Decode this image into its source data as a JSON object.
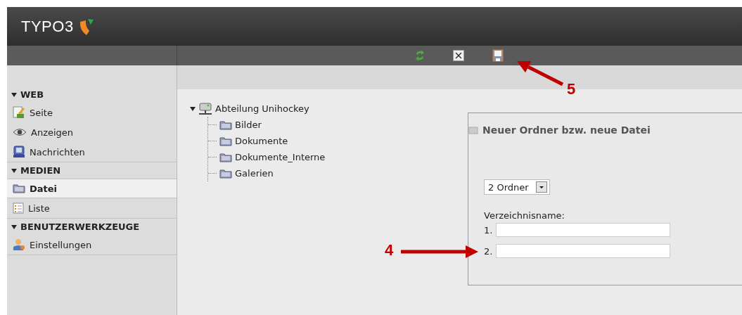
{
  "header": {
    "logo": "TYPO3"
  },
  "toolbar": {
    "buttons": [
      {
        "kind": "refresh"
      },
      {
        "kind": "close"
      },
      {
        "kind": "save"
      }
    ]
  },
  "sidebar": {
    "groups": [
      {
        "title": "WEB",
        "expanded": true,
        "items": [
          {
            "label": "Seite",
            "kind": "page",
            "selected": false
          },
          {
            "label": "Anzeigen",
            "kind": "eye",
            "selected": false
          },
          {
            "label": "Nachrichten",
            "kind": "news",
            "selected": false
          }
        ]
      },
      {
        "title": "MEDIEN",
        "expanded": true,
        "items": [
          {
            "label": "Datei",
            "kind": "folder",
            "selected": true
          },
          {
            "label": "Liste",
            "kind": "list",
            "selected": false
          }
        ]
      },
      {
        "title": "BENUTZERWERKZEUGE",
        "expanded": true,
        "items": [
          {
            "label": "Einstellungen",
            "kind": "user",
            "selected": false
          }
        ]
      }
    ]
  },
  "tree": {
    "label": "Abteilung Unihockey",
    "expanded": true,
    "children": [
      {
        "label": "Bilder"
      },
      {
        "label": "Dokumente"
      },
      {
        "label": "Dokumente_Interne"
      },
      {
        "label": "Galerien"
      }
    ]
  },
  "panel": {
    "title": "Neuer Ordner bzw. neue Datei",
    "select": {
      "value": "2 Ordner"
    },
    "field_label": "Verzeichnisname:",
    "fields": [
      {
        "number": "1."
      },
      {
        "number": "2."
      }
    ]
  },
  "annotations": [
    {
      "label": "5",
      "kind": "toolbar"
    },
    {
      "label": "4",
      "kind": "form"
    }
  ]
}
